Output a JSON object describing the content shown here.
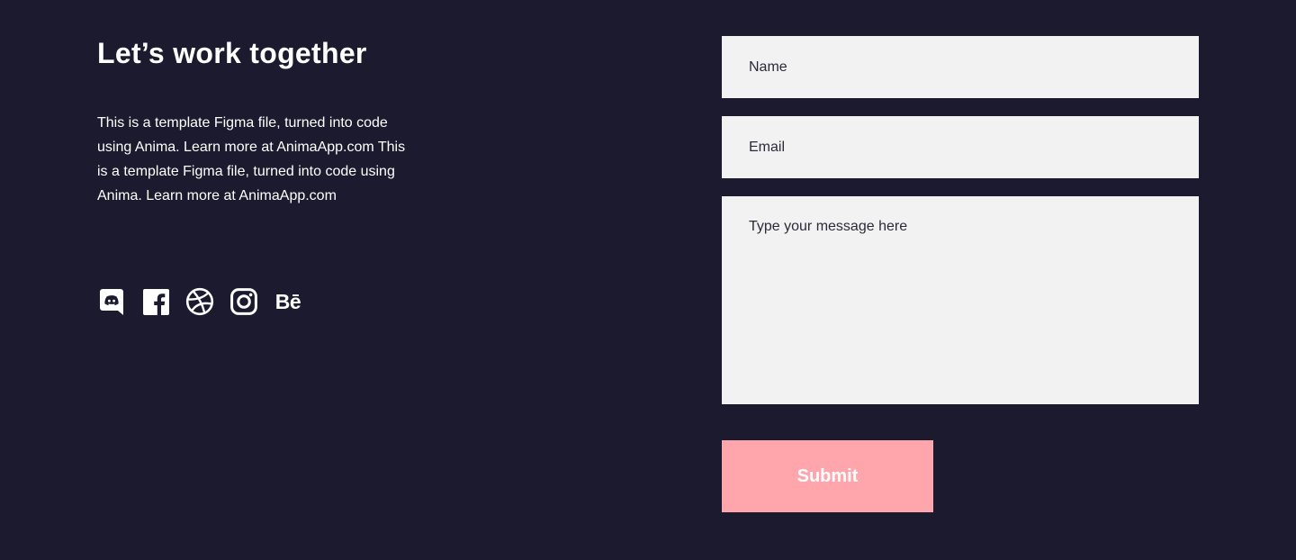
{
  "contact": {
    "heading": "Let’s work together",
    "description": "This is a template Figma file, turned into code using Anima. Learn more at AnimaApp.com This is a template Figma file, turned into code using Anima. Learn more at AnimaApp.com"
  },
  "social": [
    {
      "icon": "discord-icon"
    },
    {
      "icon": "facebook-icon"
    },
    {
      "icon": "dribbble-icon"
    },
    {
      "icon": "instagram-icon"
    },
    {
      "icon": "behance-icon",
      "text": "Bē"
    }
  ],
  "form": {
    "name_placeholder": "Name",
    "email_placeholder": "Email",
    "message_placeholder": "Type your message here",
    "submit_label": "Submit"
  },
  "colors": {
    "background": "#1b1a2e",
    "field_background": "#f2f2f2",
    "accent": "#ffa6ad",
    "text": "#ffffff"
  }
}
